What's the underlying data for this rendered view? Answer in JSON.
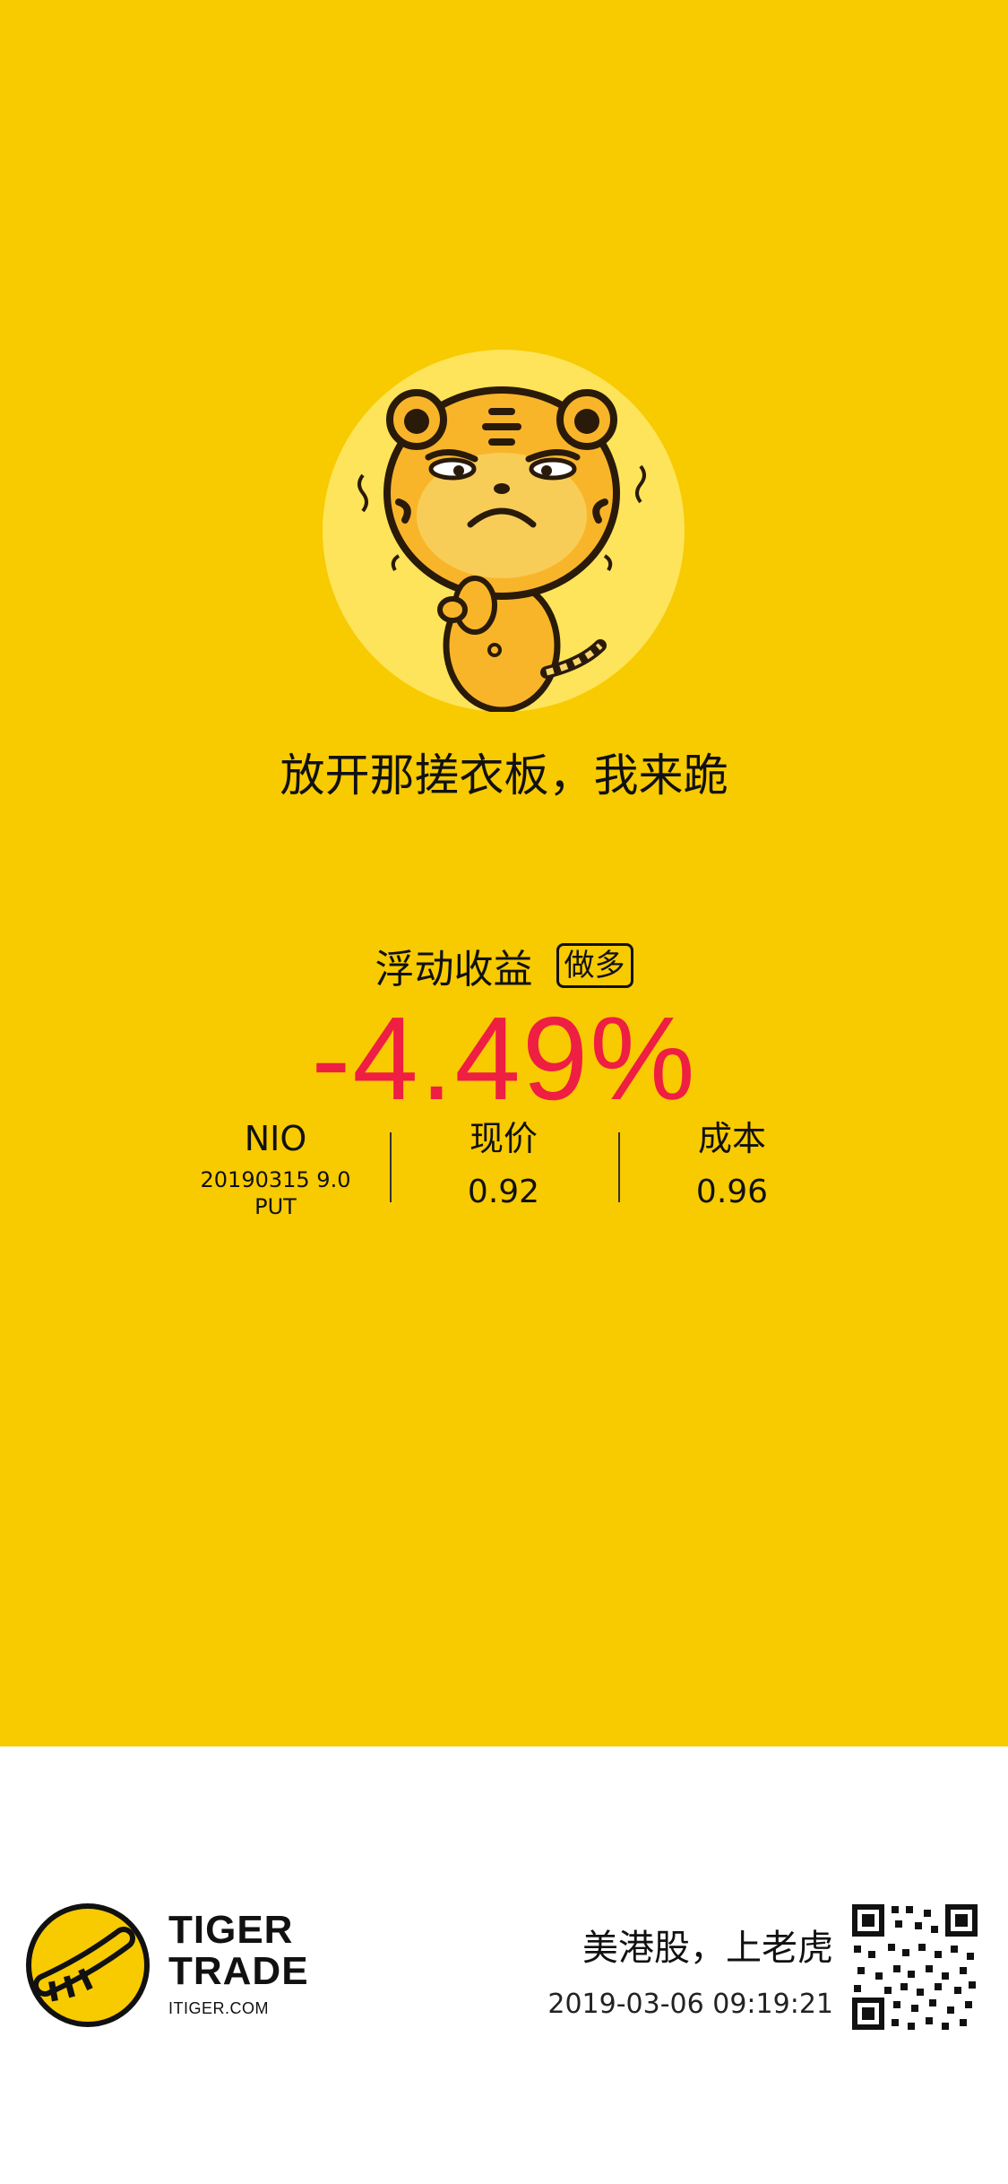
{
  "caption": "放开那搓衣板，我来跪",
  "profit": {
    "label": "浮动收益",
    "tag": "做多",
    "percent": "-4.49%",
    "color": "#ef1e43"
  },
  "stats": {
    "symbol": "NIO",
    "contract_line": "20190315  9.0",
    "contract_type": "PUT",
    "current_label": "现价",
    "current_value": "0.92",
    "cost_label": "成本",
    "cost_value": "0.96"
  },
  "footer": {
    "brand_line1": "TIGER",
    "brand_line2": "TRADE",
    "brand_site": "ITIGER.COM",
    "slogan": "美港股，上老虎",
    "timestamp": "2019-03-06 09:19:21"
  },
  "icons": {
    "mascot": "tiger-mascot-icon",
    "logo": "tiger-trade-logo-icon",
    "qr": "qr-code-icon"
  },
  "colors": {
    "background_top": "#f8ca00",
    "background_bottom": "#ffffff",
    "accent_red": "#ef1e43"
  }
}
